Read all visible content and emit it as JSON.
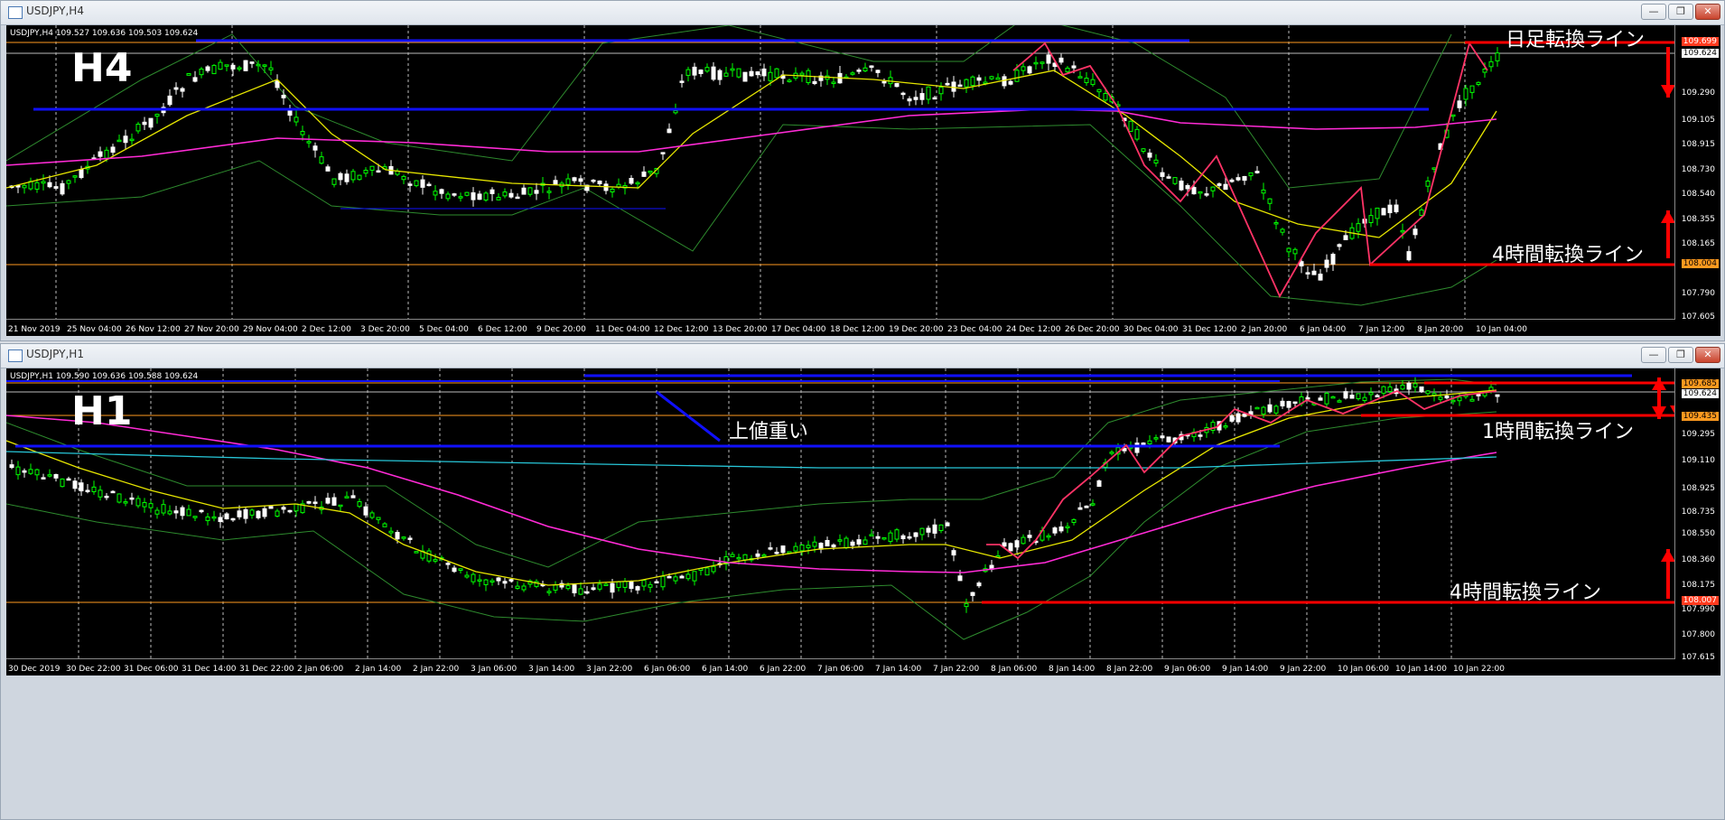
{
  "windows": [
    {
      "title": "USDJPY,H4",
      "ohlc": "USDJPY,H4  109.527 109.636 109.503 109.624",
      "timeframe_label": "H4",
      "annotations": [
        "日足転換ライン",
        "4時間転換ライン"
      ],
      "price_ticks": [
        "109.290",
        "109.105",
        "108.915",
        "108.730",
        "108.540",
        "108.355",
        "108.165",
        "107.790",
        "107.605"
      ],
      "price_boxes": [
        {
          "text": "109.699",
          "color": "#ff3b1f",
          "fg": "#fff"
        },
        {
          "text": "109.624",
          "color": "#ffffff",
          "fg": "#000"
        },
        {
          "text": "108.004",
          "color": "#ff9a1f",
          "fg": "#000"
        }
      ],
      "time_ticks": [
        "21 Nov 2019",
        "25 Nov 04:00",
        "26 Nov 12:00",
        "27 Nov 20:00",
        "29 Nov 04:00",
        "2 Dec 12:00",
        "3 Dec 20:00",
        "5 Dec 04:00",
        "6 Dec 12:00",
        "9 Dec 20:00",
        "11 Dec 04:00",
        "12 Dec 12:00",
        "13 Dec 20:00",
        "17 Dec 04:00",
        "18 Dec 12:00",
        "19 Dec 20:00",
        "23 Dec 04:00",
        "24 Dec 12:00",
        "26 Dec 20:00",
        "30 Dec 04:00",
        "31 Dec 12:00",
        "2 Jan 20:00",
        "6 Jan 04:00",
        "7 Jan 12:00",
        "8 Jan 20:00",
        "10 Jan 04:00"
      ]
    },
    {
      "title": "USDJPY,H1",
      "ohlc": "USDJPY,H1  109.590 109.636 109.588 109.624",
      "timeframe_label": "H1",
      "annotations": [
        "上値重い",
        "1時間転換ライン",
        "4時間転換ライン"
      ],
      "price_ticks": [
        "109.295",
        "109.110",
        "108.925",
        "108.735",
        "108.550",
        "108.360",
        "108.175",
        "107.990",
        "107.800",
        "107.615"
      ],
      "price_boxes": [
        {
          "text": "109.685",
          "color": "#ff9a1f",
          "fg": "#000"
        },
        {
          "text": "109.624",
          "color": "#ffffff",
          "fg": "#000"
        },
        {
          "text": "109.435",
          "color": "#ff9a1f",
          "fg": "#000"
        },
        {
          "text": "108.007",
          "color": "#ff3b1f",
          "fg": "#fff"
        }
      ],
      "time_ticks": [
        "30 Dec 2019",
        "30 Dec 22:00",
        "31 Dec 06:00",
        "31 Dec 14:00",
        "31 Dec 22:00",
        "2 Jan 06:00",
        "2 Jan 14:00",
        "2 Jan 22:00",
        "3 Jan 06:00",
        "3 Jan 14:00",
        "3 Jan 22:00",
        "6 Jan 06:00",
        "6 Jan 14:00",
        "6 Jan 22:00",
        "7 Jan 06:00",
        "7 Jan 14:00",
        "7 Jan 22:00",
        "8 Jan 06:00",
        "8 Jan 14:00",
        "8 Jan 22:00",
        "9 Jan 06:00",
        "9 Jan 14:00",
        "9 Jan 22:00",
        "10 Jan 06:00",
        "10 Jan 14:00",
        "10 Jan 22:00"
      ]
    }
  ],
  "window_buttons": {
    "minimize": "—",
    "restore": "❐",
    "close": "✕"
  },
  "colors": {
    "bull": "#00ff00",
    "bear": "#ffffff",
    "ma_fast": "#e6e600",
    "ma_slow": "#ff2bd6",
    "bands": "#2e8b2e",
    "blue_line": "#1010ff",
    "red_line": "#ff0000",
    "zigzag": "#ff3366",
    "cyan": "#27c6d8"
  }
}
